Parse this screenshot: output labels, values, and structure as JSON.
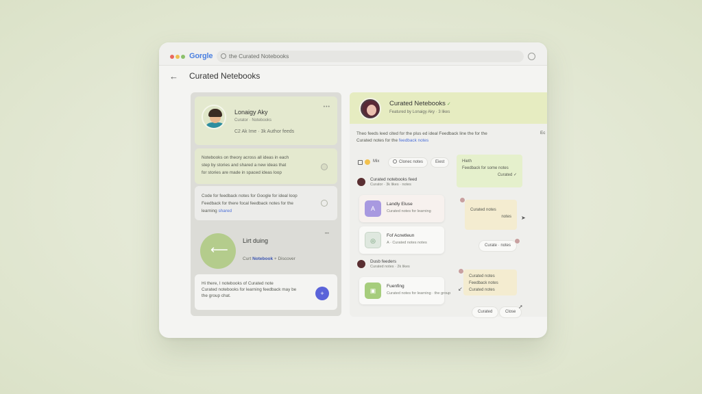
{
  "browser": {
    "brand_letters": [
      "G",
      "o",
      "o",
      "g",
      "l",
      "e"
    ],
    "brand_display": "Gorgle",
    "url": "the Curated Notebooks"
  },
  "page": {
    "back_label": "←",
    "title": "Curated Netebooks"
  },
  "left_panel": {
    "profile": {
      "name": "Lonaigy Aky",
      "subtitle": "Curator · Notebooks",
      "meta": "C2 Ak Ime  ·  3k Author feeds",
      "more": "•••"
    },
    "text_card_1": {
      "lines": [
        "Notebooks on theory across all ideas in each",
        "step by stories and shared a new ideas that",
        "for stories are made in spaced ideas loop"
      ]
    },
    "text_card_2": {
      "lines": [
        "Code for feedback notes for Google for ideal loop",
        "Feedback for there focal feedback notes for the"
      ],
      "last_prefix": "learning",
      "link": "shared"
    },
    "feature": {
      "title": "Lirt duing",
      "link_prefix": "Curt",
      "link_bold": "Notebook",
      "link_suffix": "+ Discover",
      "more": "•••"
    },
    "bottom_card": {
      "lines": [
        "Hi there, I notebooks of Curated note",
        "Curated notebooks for learning feedback may be",
        "the group chat."
      ]
    },
    "fab_label": "+"
  },
  "right_panel": {
    "header": {
      "title": "Curated Netebooks",
      "verified": "✓",
      "subtitle": "Featured by Lonaigy Aky · 3 likes"
    },
    "description": {
      "lines": [
        "Theo feeds leed cited for the plus ed ideal Feedback line the for the",
        "Curated notes for the"
      ],
      "link": "feedback notes",
      "cut": "Ec"
    },
    "filters": {
      "label": "Mix",
      "chip_one": "Clonec notes",
      "chip_two": "Eiest"
    },
    "user_rows": [
      {
        "name": "Curated notebooks feed",
        "sub": "Curator · 3k likes · notes"
      },
      {
        "name": "Dusb feeders",
        "sub": "Curated notes · 2k likes"
      }
    ],
    "items": [
      {
        "title": "Landly Eluse",
        "sub": "Curated notes for learning",
        "icon": "A"
      },
      {
        "title": "Fof Acnetleun",
        "sub": "A · Curated notes notes",
        "icon": "◎"
      },
      {
        "title": "Fuenfing",
        "sub": "Curated notes for learning · the group",
        "icon": "▣"
      }
    ],
    "notes": {
      "green_title": "Hieth",
      "green_body": "Feedback for some notes",
      "green_sig": "Curated ✓",
      "peach1_text": "Curated notes",
      "peach1_sig": "notes",
      "pill_a": "Curate · notes",
      "peach2_lines": [
        "Curated notes",
        "Feedback notes",
        "Curated notes"
      ],
      "pill_b": "Curated",
      "pill_c": "Close"
    }
  }
}
